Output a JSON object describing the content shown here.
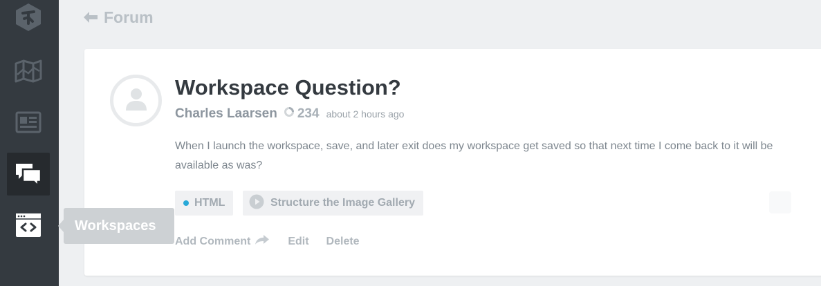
{
  "sidebar": {
    "items": [
      {
        "name": "treehouse-logo-icon"
      },
      {
        "name": "tracks-map-icon"
      },
      {
        "name": "library-book-icon"
      },
      {
        "name": "community-chat-icon",
        "active": true
      },
      {
        "name": "workspaces-code-icon"
      }
    ],
    "tooltip": "Workspaces"
  },
  "header": {
    "back_icon": "arrow-left-icon",
    "title": "Forum"
  },
  "post": {
    "title": "Workspace Question?",
    "author": "Charles Laarsen",
    "points": "234",
    "timestamp": "about 2 hours ago",
    "body": "When I launch the workspace, save, and later exit does my workspace get saved so that next time I come back to it will be available as was?",
    "tags": [
      {
        "label": "HTML",
        "dot_color": "#28a9d8"
      },
      {
        "label": "Structure the Image Gallery",
        "icon": "play-icon"
      }
    ],
    "actions": {
      "add_comment": "Add Comment",
      "edit": "Edit",
      "delete": "Delete"
    }
  },
  "colors": {
    "sidebar_bg": "#343a40",
    "page_bg": "#eef0f2",
    "accent": "#28a9d8",
    "title_text": "#343a40"
  }
}
